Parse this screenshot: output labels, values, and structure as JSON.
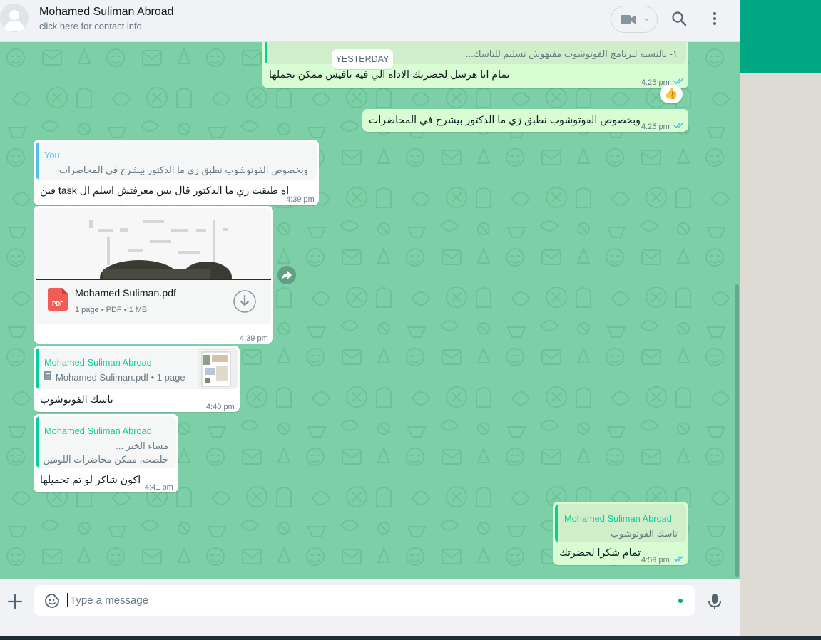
{
  "header": {
    "contact_name": "Mohamed Suliman Abroad",
    "contact_sub": "click here for contact info"
  },
  "date_divider": "YESTERDAY",
  "messages": [
    {
      "id": "m1",
      "quote_text": "١- بالنسبه لبرنامج الفوتوشوب مفيهوش تسليم للتاسك...",
      "text": "تمام انا هرسل لحضرتك الاداة الي فيه نافيس ممكن نحملها",
      "time": "4:25 pm",
      "reaction": "👍"
    },
    {
      "id": "m2",
      "text": "وبخصوص الفوتوشوب نطبق زي ما الدكتور بيشرح في المحاضرات",
      "time": "4:25 pm"
    },
    {
      "id": "m3",
      "quote_name": "You",
      "quote_text": "وبخصوص الفوتوشوب نطبق زي ما الدكتور بيشرح في المحاضرات",
      "text": "اه طبقت زي ما الدكتور قال بس معرفتش اسلم ال task فين",
      "time": "4:39 pm"
    },
    {
      "id": "m4",
      "file_name": "Mohamed Suliman.pdf",
      "file_meta": "1 page • PDF • 1 MB",
      "file_badge": "PDF",
      "time": "4:39 pm"
    },
    {
      "id": "m5",
      "quote_name": "Mohamed Suliman Abroad",
      "quote_text": "Mohamed Suliman.pdf • 1 page",
      "text": "تاسك الفوتوشوب",
      "time": "4:40 pm"
    },
    {
      "id": "m6",
      "quote_name": "Mohamed Suliman Abroad",
      "quote_line1": "مساء الخير ...",
      "quote_line2": "خلصت، ممكن محاضرات اللومين",
      "text": "اكون شاكر لو تم تحميلها",
      "time": "4:41 pm"
    },
    {
      "id": "m7",
      "quote_name": "Mohamed Suliman Abroad",
      "quote_text": "تاسك الفوتوشوب",
      "text": "تمام شكرا لحضرتك",
      "time": "4:59 pm"
    }
  ],
  "composer": {
    "placeholder": "Type a message"
  },
  "colors": {
    "accent": "#00a884",
    "outgoing_bubble": "#d9fdd3",
    "incoming_bubble": "#ffffff",
    "read_ticks": "#53bdeb",
    "quote_name": "#06cf9c"
  }
}
